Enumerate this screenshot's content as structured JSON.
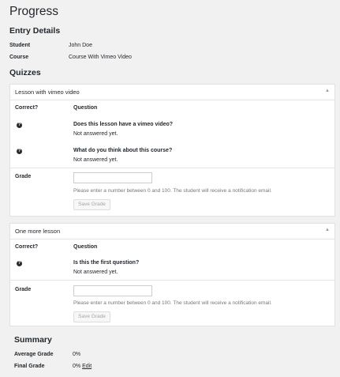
{
  "page": {
    "title": "Progress"
  },
  "entry_details": {
    "heading": "Entry Details",
    "student_label": "Student",
    "student_value": "John Doe",
    "course_label": "Course",
    "course_value": "Course With Vimeo Video"
  },
  "quizzes": {
    "heading": "Quizzes",
    "lessons": [
      {
        "title": "Lesson with vimeo video",
        "col_correct": "Correct?",
        "col_question": "Question",
        "questions": [
          {
            "text": "Does this lesson have a vimeo video?",
            "answer": "Not answered yet."
          },
          {
            "text": "What do you think about this course?",
            "answer": "Not answered yet."
          }
        ],
        "grade_label": "Grade",
        "grade_value": "",
        "hint": "Please enter a number between 0 and 100. The student will receive a notification email.",
        "save_label": "Save Grade"
      },
      {
        "title": "One more lesson",
        "col_correct": "Correct?",
        "col_question": "Question",
        "questions": [
          {
            "text": "Is this the first question?",
            "answer": "Not answered yet."
          }
        ],
        "grade_label": "Grade",
        "grade_value": "",
        "hint": "Please enter a number between 0 and 100. The student will receive a notification email.",
        "save_label": "Save Grade"
      }
    ]
  },
  "summary": {
    "heading": "Summary",
    "average_label": "Average Grade",
    "average_value": "0%",
    "final_label": "Final Grade",
    "final_value": "0%",
    "edit_label": "Edit"
  },
  "icons": {
    "question": "?",
    "toggle": "▲"
  }
}
